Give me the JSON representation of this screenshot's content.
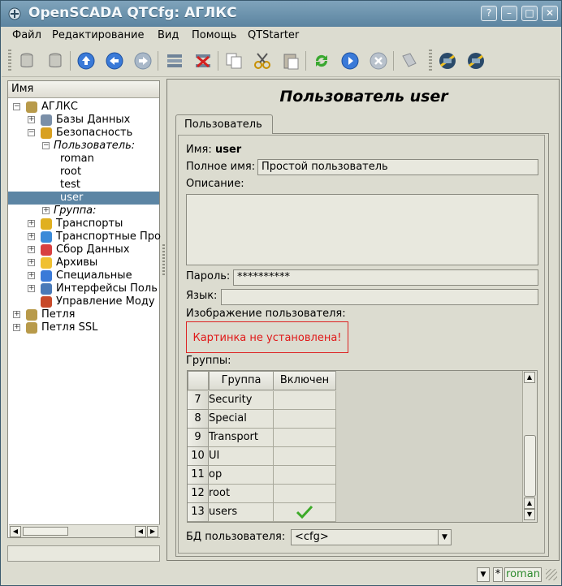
{
  "window": {
    "title": "OpenSCADA QTCfg: АГЛКС",
    "btn_help": "?",
    "btn_min": "–",
    "btn_max": "□",
    "btn_close": "✕"
  },
  "menu": [
    "Файл",
    "Редактирование",
    "Вид",
    "Помощь",
    "QTStarter"
  ],
  "toolbar": {
    "icons": [
      "db-load-icon",
      "db-save-icon",
      "up-icon",
      "back-icon",
      "forward-icon",
      "add-item-icon",
      "delete-item-icon",
      "copy-icon",
      "cut-icon",
      "paste-icon",
      "refresh-icon",
      "start-icon",
      "stop-icon",
      "manual-icon",
      "station-icon-1",
      "station-icon-2"
    ]
  },
  "tree": {
    "header": "Имя",
    "nodes": [
      {
        "label": "АГЛКС",
        "level": 0,
        "expander": "−",
        "icon": "station"
      },
      {
        "label": "Базы Данных",
        "level": 1,
        "expander": "+",
        "icon": "database"
      },
      {
        "label": "Безопасность",
        "level": 1,
        "expander": "−",
        "icon": "users"
      },
      {
        "label": "Пользователь:",
        "level": 2,
        "expander": "−",
        "icon": "",
        "italic": true
      },
      {
        "label": "roman",
        "level": 3,
        "expander": "",
        "icon": ""
      },
      {
        "label": "root",
        "level": 3,
        "expander": "",
        "icon": ""
      },
      {
        "label": "test",
        "level": 3,
        "expander": "",
        "icon": ""
      },
      {
        "label": "user",
        "level": 3,
        "expander": "",
        "icon": "",
        "selected": true
      },
      {
        "label": "Группа:",
        "level": 2,
        "expander": "+",
        "icon": "",
        "italic": true
      },
      {
        "label": "Транспорты",
        "level": 1,
        "expander": "+",
        "icon": "transport"
      },
      {
        "label": "Транспортные Про",
        "level": 1,
        "expander": "+",
        "icon": "protocol"
      },
      {
        "label": "Сбор Данных",
        "level": 1,
        "expander": "+",
        "icon": "daq"
      },
      {
        "label": "Архивы",
        "level": 1,
        "expander": "+",
        "icon": "archive"
      },
      {
        "label": "Специальные",
        "level": 1,
        "expander": "+",
        "icon": "special"
      },
      {
        "label": "Интерфейсы Поль",
        "level": 1,
        "expander": "+",
        "icon": "ui"
      },
      {
        "label": "Управление Моду",
        "level": 1,
        "expander": "",
        "icon": "modules"
      },
      {
        "label": "Петля",
        "level": 0,
        "expander": "+",
        "icon": "station"
      },
      {
        "label": "Петля SSL",
        "level": 0,
        "expander": "+",
        "icon": "station"
      }
    ]
  },
  "panel": {
    "title": "Пользователь user",
    "tab": "Пользователь",
    "name_label": "Имя:",
    "name_value": "user",
    "fullname_label": "Полное имя:",
    "fullname_value": "Простой пользователь",
    "description_label": "Описание:",
    "password_label": "Пароль:",
    "password_value": "**********",
    "lang_label": "Язык:",
    "lang_value": "",
    "picture_label": "Изображение пользователя:",
    "picture_value": "Картинка не установлена!",
    "groups_label": "Группы:",
    "db_label": "БД пользователя:",
    "db_value": "<cfg>"
  },
  "groups_table": {
    "columns": [
      "Группа",
      "Включен"
    ],
    "rows": [
      {
        "n": "7",
        "group": "Security",
        "enabled": false
      },
      {
        "n": "8",
        "group": "Special",
        "enabled": false
      },
      {
        "n": "9",
        "group": "Transport",
        "enabled": false
      },
      {
        "n": "10",
        "group": "UI",
        "enabled": false
      },
      {
        "n": "11",
        "group": "op",
        "enabled": false
      },
      {
        "n": "12",
        "group": "root",
        "enabled": false
      },
      {
        "n": "13",
        "group": "users",
        "enabled": true
      }
    ]
  },
  "statusbar": {
    "user": "roman",
    "modified": "*"
  },
  "colors": {
    "accent": "#5c85a4",
    "titlebar": "#6f93ab",
    "error": "#e01818",
    "check": "#3caa28"
  }
}
